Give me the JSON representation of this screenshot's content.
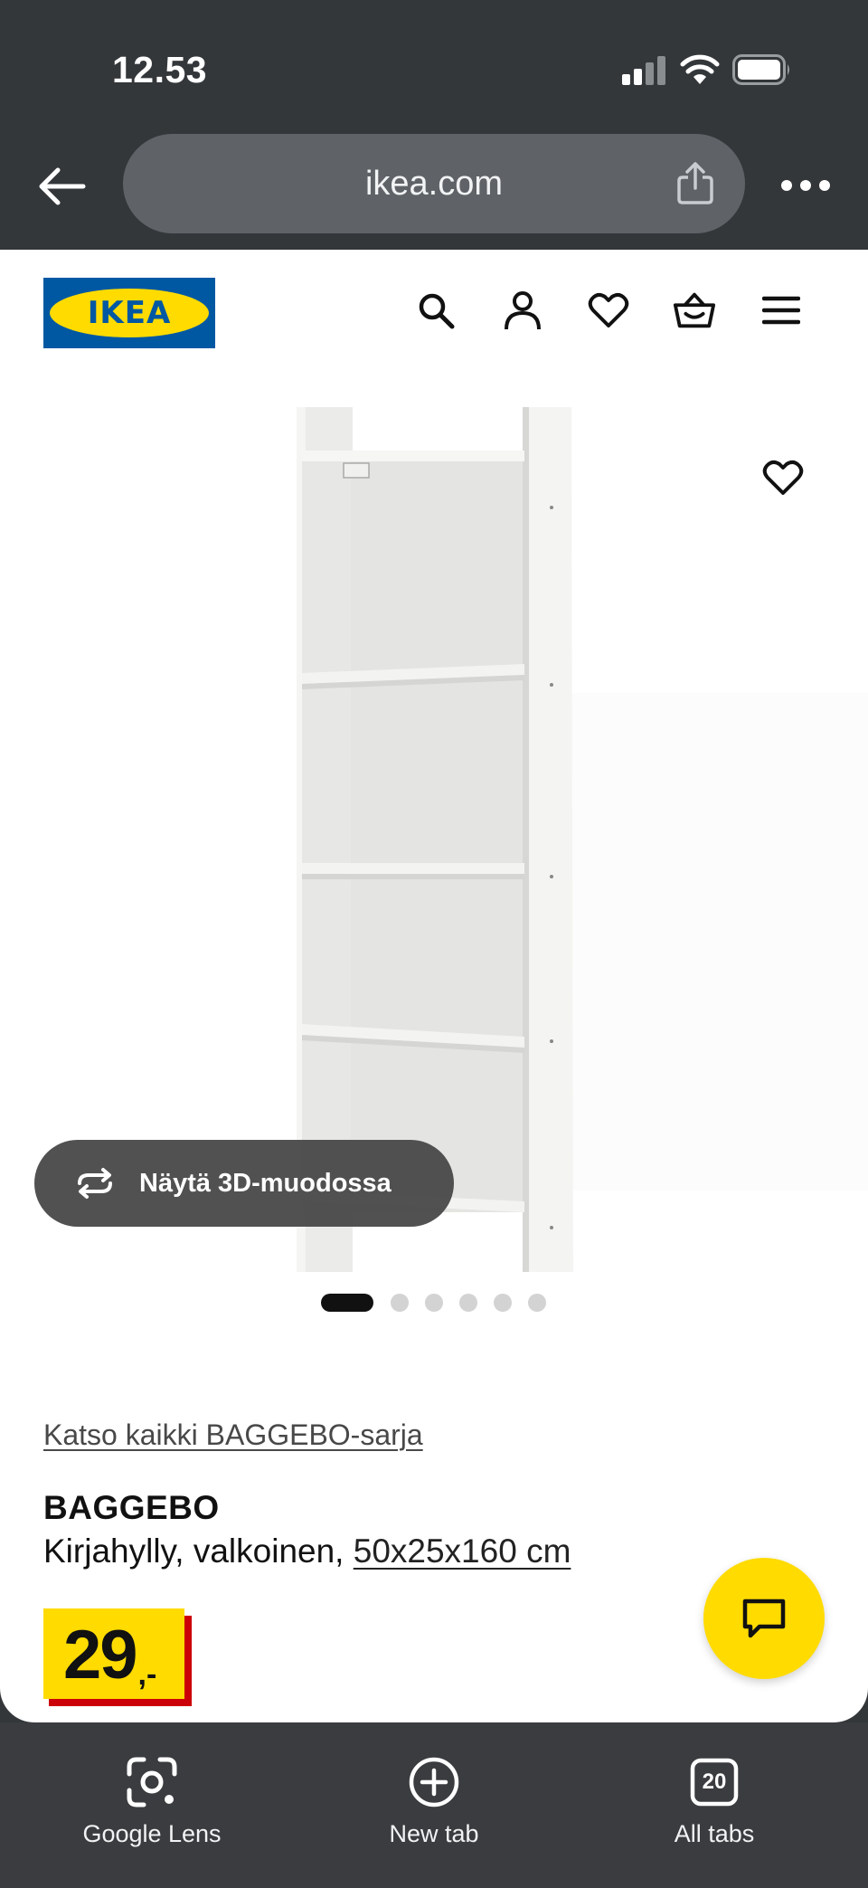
{
  "status_bar": {
    "time": "12.53",
    "icons": [
      "cellular-signal-icon",
      "wifi-icon",
      "battery-icon"
    ]
  },
  "browser": {
    "url": "ikea.com",
    "icons": [
      "back-arrow-icon",
      "share-icon",
      "more-dots-icon"
    ]
  },
  "site_header": {
    "logo_text": "IKEA",
    "icons": [
      "search-icon",
      "account-icon",
      "favourites-heart-icon",
      "shopping-basket-icon",
      "menu-icon"
    ]
  },
  "product": {
    "view_3d_label": "Näytä 3D-muodossa",
    "carousel": {
      "total": 6,
      "active_index": 0
    },
    "series_link": "Katso kaikki BAGGEBO-sarja",
    "name": "BAGGEBO",
    "description": "Kirjahylly, valkoinen, ",
    "size": "50x25x160 cm",
    "price_integer": "29",
    "price_decimals": ",-"
  },
  "toolbar": {
    "items": [
      {
        "label": "Google Lens",
        "icon": "google-lens-icon"
      },
      {
        "label": "New tab",
        "icon": "new-tab-plus-icon"
      },
      {
        "label": "All tabs",
        "icon": "all-tabs-icon",
        "count": "20"
      }
    ]
  },
  "colors": {
    "ikea_blue": "#0058a3",
    "ikea_yellow": "#ffdb00",
    "price_red": "#cc0008",
    "chrome_dark": "#34373a"
  }
}
